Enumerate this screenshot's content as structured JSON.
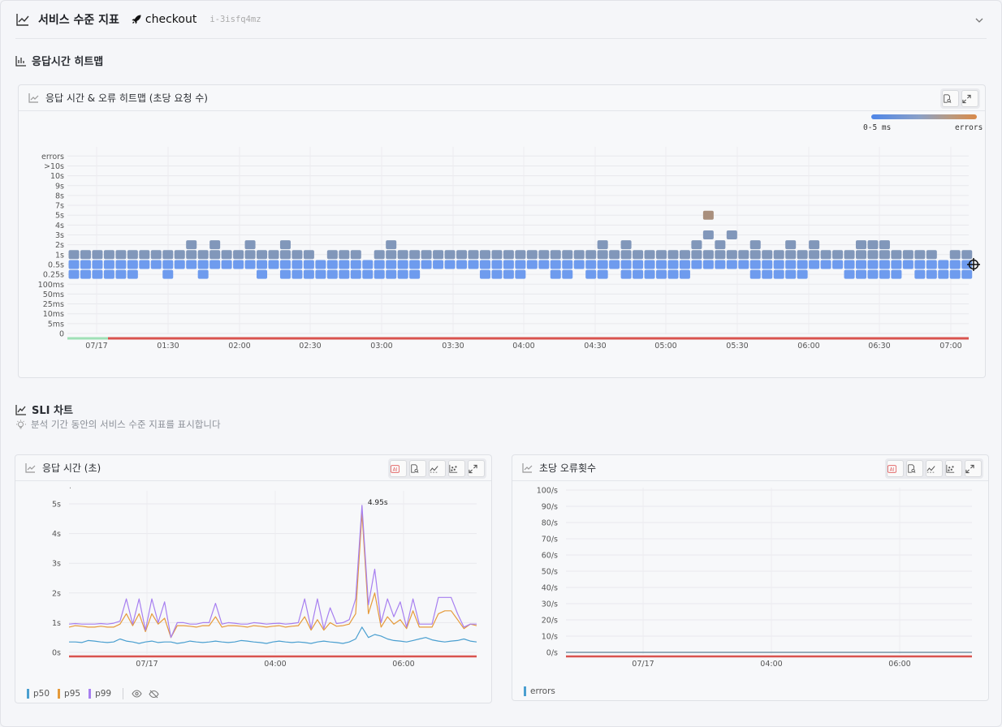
{
  "header": {
    "title": "서비스 수준 지표",
    "service": "checkout",
    "instance": "i-3isfq4mz"
  },
  "heatmap_section": {
    "title": "응답시간 히트맵"
  },
  "heatmap_panel": {
    "title": "응답 시간 & 오류 히트맵 (초당 요청 수)",
    "legend_min": "0-5 ms",
    "legend_max": "errors",
    "colors": {
      "fast": "#6e9bee",
      "slow": "#8197ba",
      "error": "#a98f7d",
      "ok_line": "#9fe0b6",
      "error_line": "#d9534f"
    }
  },
  "sli_section": {
    "title": "SLI 차트",
    "hint": "분석 기간 동안의 서비스 수준 지표를 표시합니다"
  },
  "latency_panel": {
    "title": "응답 시간 (초)",
    "peak_label": "4.95s",
    "legend": [
      "p50",
      "p95",
      "p99"
    ],
    "colors": {
      "p50": "#4a9fd0",
      "p95": "#e59a3a",
      "p99": "#a77ff0"
    }
  },
  "error_panel": {
    "title": "초당 오류횟수",
    "legend": [
      "errors"
    ],
    "colors": {
      "errors": "#4a9fd0"
    }
  },
  "chart_data": [
    {
      "type": "heatmap",
      "title": "응답 시간 & 오류 히트맵 (초당 요청 수)",
      "y_categories": [
        "0",
        "5ms",
        "10ms",
        "25ms",
        "50ms",
        "100ms",
        "0.25s",
        "0.5s",
        "1s",
        "2s",
        "3s",
        "4s",
        "5s",
        "7s",
        "8s",
        "9s",
        "10s",
        ">10s",
        "errors"
      ],
      "x_ticks": [
        "07/17",
        "01:30",
        "02:00",
        "02:30",
        "03:00",
        "03:30",
        "04:00",
        "04:30",
        "05:00",
        "05:30",
        "06:00",
        "06:30",
        "07:00"
      ],
      "x_range": [
        "01:10",
        "07:10"
      ],
      "columns": 77,
      "row_0_25s": [
        0,
        1,
        2,
        3,
        4,
        5,
        8,
        11,
        16,
        18,
        19,
        20,
        21,
        22,
        23,
        24,
        25,
        26,
        27,
        28,
        29,
        35,
        36,
        37,
        38,
        41,
        42,
        44,
        45,
        47,
        48,
        49,
        50,
        51,
        52,
        58,
        59,
        60,
        61,
        62,
        66,
        67,
        68,
        69,
        70,
        72,
        73,
        74,
        75,
        76
      ],
      "row_0_5s": [
        0,
        1,
        2,
        3,
        4,
        5,
        6,
        7,
        8,
        9,
        10,
        11,
        12,
        13,
        14,
        15,
        16,
        17,
        18,
        19,
        20,
        21,
        22,
        23,
        24,
        25,
        26,
        27,
        28,
        29,
        30,
        31,
        32,
        33,
        34,
        35,
        36,
        37,
        38,
        39,
        40,
        41,
        42,
        43,
        44,
        45,
        46,
        47,
        48,
        49,
        50,
        51,
        52,
        53,
        54,
        55,
        56,
        57,
        58,
        59,
        60,
        61,
        62,
        63,
        64,
        65,
        66,
        67,
        68,
        69,
        70,
        71,
        72,
        73,
        74,
        75,
        76
      ],
      "row_1s": [
        0,
        1,
        2,
        3,
        4,
        5,
        6,
        7,
        8,
        9,
        10,
        11,
        12,
        13,
        14,
        15,
        16,
        17,
        18,
        19,
        20,
        22,
        23,
        24,
        26,
        27,
        28,
        29,
        30,
        31,
        32,
        33,
        34,
        35,
        36,
        37,
        38,
        39,
        40,
        41,
        42,
        43,
        44,
        45,
        46,
        47,
        48,
        49,
        50,
        51,
        52,
        53,
        54,
        55,
        56,
        57,
        58,
        59,
        60,
        61,
        62,
        63,
        64,
        65,
        66,
        67,
        68,
        69,
        70,
        71,
        72,
        73,
        75,
        76
      ],
      "row_2s": [
        10,
        12,
        15,
        18,
        27,
        45,
        47,
        53,
        55,
        58,
        61,
        63,
        67,
        68,
        69
      ],
      "row_3s": [
        54,
        56
      ],
      "row_5s": [
        54
      ],
      "error_line_start": "07/17"
    },
    {
      "type": "line",
      "title": "응답 시간 (초)",
      "x_ticks": [
        "07/17",
        "04:00",
        "06:00"
      ],
      "y_ticks": [
        "0s",
        "1s",
        "2s",
        "3s",
        "4s",
        "5s"
      ],
      "ylim": [
        0,
        5.5
      ],
      "points": 65,
      "series": [
        {
          "name": "p50",
          "values": [
            0.35,
            0.35,
            0.33,
            0.4,
            0.38,
            0.35,
            0.33,
            0.35,
            0.45,
            0.38,
            0.35,
            0.3,
            0.35,
            0.38,
            0.33,
            0.35,
            0.35,
            0.3,
            0.33,
            0.38,
            0.35,
            0.33,
            0.35,
            0.38,
            0.35,
            0.33,
            0.35,
            0.4,
            0.38,
            0.35,
            0.33,
            0.3,
            0.35,
            0.38,
            0.35,
            0.33,
            0.35,
            0.33,
            0.3,
            0.35,
            0.38,
            0.35,
            0.33,
            0.3,
            0.35,
            0.45,
            0.85,
            0.5,
            0.6,
            0.55,
            0.45,
            0.4,
            0.38,
            0.35,
            0.4,
            0.45,
            0.5,
            0.42,
            0.38,
            0.35,
            0.38,
            0.4,
            0.45,
            0.38,
            0.35
          ]
        },
        {
          "name": "p95",
          "values": [
            0.85,
            0.9,
            0.88,
            0.85,
            0.85,
            0.88,
            0.85,
            0.85,
            0.95,
            1.3,
            0.9,
            1.3,
            0.7,
            1.3,
            0.95,
            1.15,
            0.5,
            0.9,
            0.9,
            0.88,
            0.85,
            0.9,
            0.9,
            1.2,
            0.85,
            0.9,
            0.9,
            0.88,
            0.85,
            0.9,
            0.88,
            0.85,
            0.88,
            0.9,
            0.85,
            0.88,
            0.9,
            1.2,
            0.75,
            1.1,
            0.75,
            1.0,
            0.88,
            0.9,
            0.95,
            1.3,
            4.7,
            1.3,
            2.0,
            0.85,
            1.2,
            0.95,
            1.1,
            0.8,
            1.4,
            0.85,
            0.85,
            0.85,
            1.3,
            1.4,
            1.4,
            1.1,
            0.8,
            0.95,
            0.9
          ]
        },
        {
          "name": "p99",
          "values": [
            0.95,
            0.97,
            0.95,
            0.95,
            0.95,
            0.97,
            0.95,
            0.98,
            1.05,
            1.8,
            0.95,
            1.8,
            0.75,
            1.8,
            1.0,
            1.7,
            0.5,
            1.0,
            1.0,
            0.95,
            0.95,
            1.0,
            1.0,
            1.65,
            0.95,
            1.0,
            0.98,
            0.95,
            0.95,
            1.0,
            0.98,
            0.95,
            0.97,
            0.98,
            0.95,
            0.97,
            1.0,
            1.8,
            0.8,
            1.8,
            0.8,
            1.5,
            0.97,
            1.0,
            1.1,
            1.8,
            4.95,
            1.6,
            2.8,
            1.0,
            1.8,
            1.2,
            1.7,
            0.85,
            1.8,
            0.95,
            0.95,
            0.95,
            1.85,
            1.85,
            1.85,
            1.3,
            0.85,
            0.95,
            0.95
          ]
        }
      ],
      "annotation": "4.95s"
    },
    {
      "type": "line",
      "title": "초당 오류횟수",
      "x_ticks": [
        "07/17",
        "04:00",
        "06:00"
      ],
      "y_ticks": [
        "0/s",
        "10/s",
        "20/s",
        "30/s",
        "40/s",
        "50/s",
        "60/s",
        "70/s",
        "80/s",
        "90/s",
        "100/s"
      ],
      "ylim": [
        0,
        100
      ],
      "series": [
        {
          "name": "errors",
          "values": [
            0,
            0,
            0,
            0,
            0,
            0,
            0,
            0,
            0,
            0,
            0,
            0
          ]
        }
      ]
    }
  ]
}
